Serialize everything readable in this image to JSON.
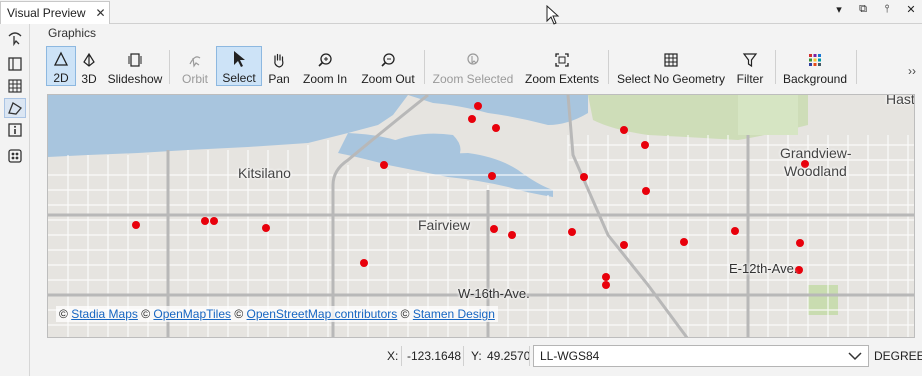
{
  "tab": {
    "title": "Visual Preview",
    "close": "✕"
  },
  "window_controls": [
    "▾",
    "⧉",
    "⫯",
    "✕"
  ],
  "ribbon": {
    "group_title": "Graphics",
    "buttons": {
      "b2d": "2D",
      "b3d": "3D",
      "slideshow": "Slideshow",
      "orbit": "Orbit",
      "select": "Select",
      "pan": "Pan",
      "zoom_in": "Zoom In",
      "zoom_out": "Zoom Out",
      "zoom_selected": "Zoom Selected",
      "zoom_extents": "Zoom Extents",
      "select_no_geometry": "Select No Geometry",
      "filter": "Filter",
      "background": "Background"
    },
    "more": "››"
  },
  "map": {
    "labels": {
      "kitsilano": "Kitsilano",
      "fairview": "Fairview",
      "grandview_1": "Grandview-",
      "grandview_2": "Woodland",
      "w16": "W-16th-Ave.",
      "e12": "E-12th-Ave.",
      "hastings": "Hasti"
    },
    "attribution": {
      "c1": "©",
      "stadia": "Stadia Maps",
      "c2": "©",
      "openmaptiles": "OpenMapTiles",
      "c3": "©",
      "osm": "OpenStreetMap contributors",
      "c4": "©",
      "stamen": "Stamen Design"
    },
    "colors": {
      "water": "#a8c5de",
      "park": "#c9dcb0",
      "land": "#e6e4e0",
      "road": "#ffffff",
      "arterial": "#b8b8b8",
      "point": "#e8000b"
    }
  },
  "status": {
    "x_label": "X:",
    "x_value": "-123.1648",
    "y_label": "Y:",
    "y_value": "49.2570",
    "crs": "LL-WGS84",
    "unit": "DEGREE"
  }
}
